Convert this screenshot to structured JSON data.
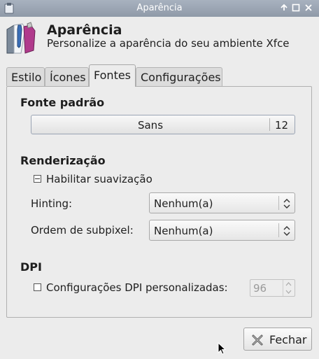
{
  "window": {
    "title": "Aparência"
  },
  "header": {
    "title": "Aparência",
    "subtitle": "Personalize a aparência do seu ambiente Xfce"
  },
  "tabs": [
    {
      "label": "Estilo",
      "active": false
    },
    {
      "label": "Ícones",
      "active": false
    },
    {
      "label": "Fontes",
      "active": true
    },
    {
      "label": "Configurações",
      "active": false
    }
  ],
  "default_font": {
    "section_title": "Fonte padrão",
    "name": "Sans",
    "size": "12"
  },
  "rendering": {
    "section_title": "Renderização",
    "antialias_label": "Habilitar suavização",
    "antialias_state": "indeterminate",
    "hinting_label": "Hinting:",
    "hinting_value": "Nenhum(a)",
    "subpixel_label": "Ordem de subpixel:",
    "subpixel_value": "Nenhum(a)"
  },
  "dpi": {
    "section_title": "DPI",
    "custom_label": "Configurações DPI personalizadas:",
    "custom_checked": false,
    "value": "96"
  },
  "footer": {
    "close_label": "Fechar"
  },
  "colors": {
    "titlebar": "#98a3b1",
    "background": "#ececec",
    "text": "#1e1e1e"
  }
}
